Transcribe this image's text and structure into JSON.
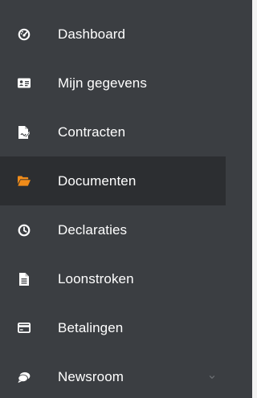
{
  "colors": {
    "sidebar_bg": "#3b3e42",
    "active_bg": "#2c2e31",
    "icon_default": "#ffffff",
    "icon_active": "#f08c1a",
    "text": "#ffffff"
  },
  "sidebar": {
    "active_index": 3,
    "items": [
      {
        "label": "Dashboard",
        "icon": "dashboard-gauge-icon"
      },
      {
        "label": "Mijn gegevens",
        "icon": "id-card-icon"
      },
      {
        "label": "Contracten",
        "icon": "file-signature-icon"
      },
      {
        "label": "Documenten",
        "icon": "folder-open-icon"
      },
      {
        "label": "Declaraties",
        "icon": "clock-icon"
      },
      {
        "label": "Loonstroken",
        "icon": "file-text-icon"
      },
      {
        "label": "Betalingen",
        "icon": "credit-card-icon"
      },
      {
        "label": "Newsroom",
        "icon": "comments-icon",
        "has_submenu": true
      }
    ]
  }
}
